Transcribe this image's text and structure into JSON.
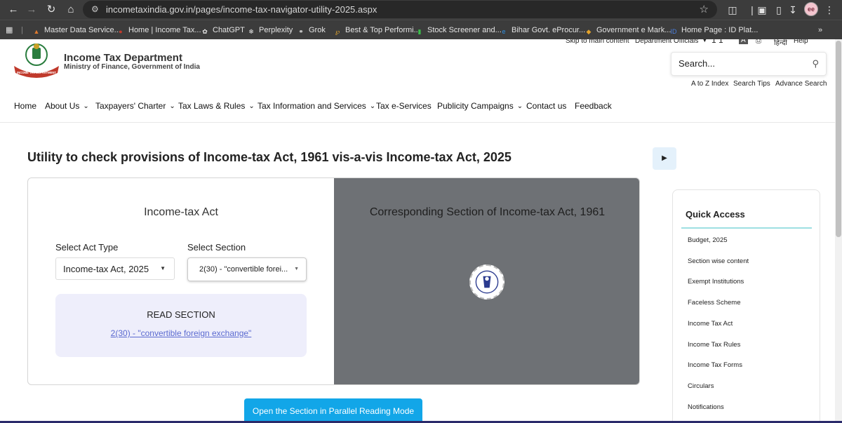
{
  "browser": {
    "url": "incometaxindia.gov.in/pages/income-tax-navigator-utility-2025.aspx",
    "profile_initials": "ee",
    "bookmarks": [
      {
        "label": "Master Data Service...",
        "icon": "mca-icon",
        "color": "#e07a2e"
      },
      {
        "label": "Home | Income Tax...",
        "icon": "itd-icon",
        "color": "#c0392b"
      },
      {
        "label": "ChatGPT",
        "icon": "chatgpt-icon",
        "color": "#e8e8e8"
      },
      {
        "label": "Perplexity",
        "icon": "perplexity-icon",
        "color": "#e8e8e8"
      },
      {
        "label": "Grok",
        "icon": "grok-icon",
        "color": "#e8e8e8"
      },
      {
        "label": "Best & Top Performi...",
        "icon": "chart-icon",
        "color": "#e5a62b"
      },
      {
        "label": "Stock Screener and...",
        "icon": "bars-icon",
        "color": "#3cbc4a"
      },
      {
        "label": "Bihar Govt. eProcur...",
        "icon": "edge-icon",
        "color": "#2e8ee0"
      },
      {
        "label": "Government e Mark...",
        "icon": "gem-icon",
        "color": "#e3a22a"
      },
      {
        "label": "Home Page : ID Plat...",
        "icon": "id-icon",
        "color": "#4a7fe0"
      }
    ]
  },
  "header": {
    "dept_name": "Income Tax Department",
    "ministry": "Ministry of Finance, Government of India",
    "logo_text": "INCOME TAX DEPARTMENT",
    "util_links": {
      "skip": "Skip to main content",
      "officials": "Department Officials",
      "font_size": "1 1",
      "a_label": "A",
      "hindi": "हिन्दी",
      "help": "Help"
    },
    "search": {
      "placeholder": "Search..."
    },
    "search_links": [
      "A to Z Index",
      "Search Tips",
      "Advance Search"
    ]
  },
  "nav": [
    {
      "label": "Home",
      "caret": false
    },
    {
      "label": "About Us",
      "caret": true
    },
    {
      "label": "Taxpayers' Charter",
      "caret": true
    },
    {
      "label": "Tax Laws & Rules",
      "caret": true
    },
    {
      "label": "Tax Information and Services",
      "caret": true
    },
    {
      "label": "Tax e-Services",
      "caret": false
    },
    {
      "label": "Publicity Campaigns",
      "caret": true
    },
    {
      "label": "Contact us",
      "caret": false
    },
    {
      "label": "Feedback",
      "caret": false
    }
  ],
  "main": {
    "title": "Utility to check provisions of Income-tax Act, 1961 vis-a-vis Income-tax Act, 2025",
    "left_heading": "Income-tax Act",
    "act_type_label": "Select Act Type",
    "act_type_value": "Income-tax Act, 2025",
    "section_label": "Select Section",
    "section_value": "2(30) - \"convertible forei...",
    "read_heading": "READ SECTION",
    "read_link": "2(30) - \"convertible foreign exchange\"",
    "right_heading": "Corresponding Section of Income-tax Act, 1961",
    "parallel_button": "Open the Section in Parallel Reading Mode"
  },
  "quick_access": {
    "title": "Quick Access",
    "items": [
      "Budget, 2025",
      "Section wise content",
      "Exempt Institutions",
      "Faceless Scheme",
      "Income Tax Act",
      "Income Tax Rules",
      "Income Tax Forms",
      "Circulars",
      "Notifications"
    ]
  },
  "colors": {
    "accent_blue": "#12a6e8",
    "read_box_bg": "#eeeefb",
    "link": "#5b6ad0",
    "right_pane_bg": "#6e7175"
  }
}
